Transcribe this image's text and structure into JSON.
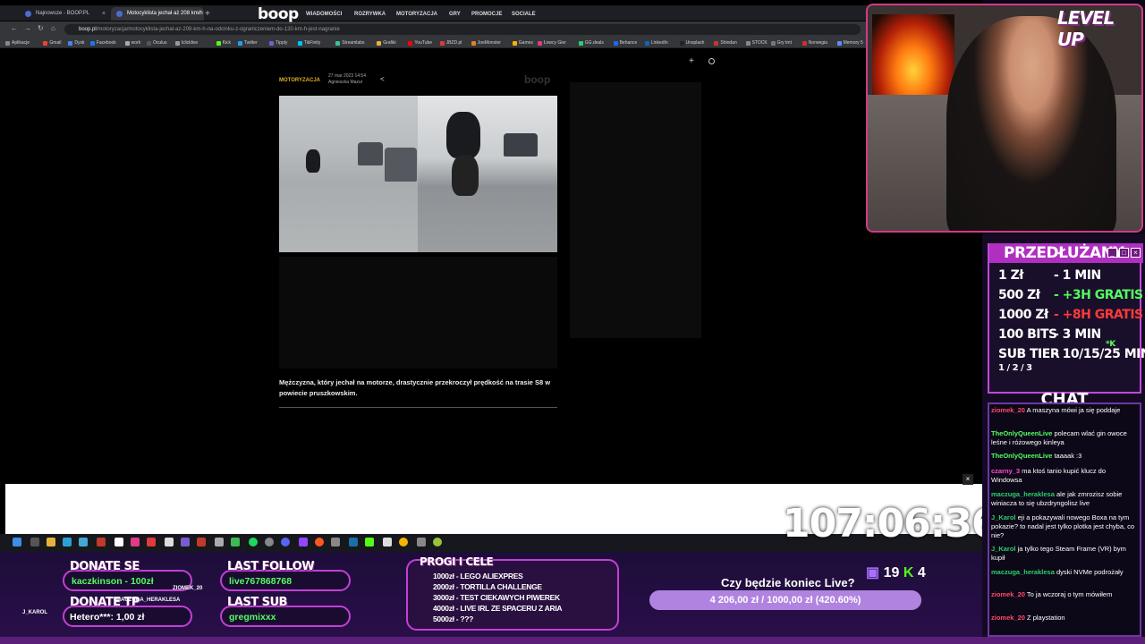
{
  "browser": {
    "tabs": [
      {
        "label": "Najnowsze - BOOP.PL"
      },
      {
        "label": "Motocyklista jechał aż 208 km/h"
      }
    ],
    "url_host": "boop.pl",
    "url_path": "/motoryzacja/motocyklista-jechal-az-208-km-h-na-odcinku-z-ograniczeniem-do-120-km-h-jest-nagranie",
    "bookmarks": [
      "Aplikacje",
      "Gmail",
      "Dysk",
      "Facebook",
      "work",
      "Oculus",
      "Iclicklive",
      "Kick",
      "Twitter",
      "Tipply",
      "TikFinity",
      "Streamlabs",
      "Grafiki",
      "YouTube",
      "JBZD.pl",
      "JoeMonster",
      "Games",
      "Łowcy Gier",
      "GG.deals",
      "Behance",
      "LinkedIn",
      "Unsplash",
      "Shindan",
      "STOCK",
      "Gry tmt",
      "Norwegia",
      "Memory 5"
    ]
  },
  "site": {
    "logo": "boop",
    "nav": [
      "WIADOMOŚCI",
      "ROZRYWKA",
      "MOTORYZACJA",
      "GRY",
      "PROMOCJE",
      "SOCIALE"
    ],
    "category": "MOTORYZACJA",
    "meta_date": "27 mar 2023 14:54",
    "meta_author": "Agnieszka Mazur",
    "watermark": "boop",
    "caption": "Mężczyzna, który jechał na motorze, drastycznie przekroczył prędkość na trasie S8 w powiecie pruszkowskim."
  },
  "timer": "107:06:36",
  "webcam": {
    "brand": "LEVEL UP"
  },
  "subathon": {
    "title": "PRZEDŁUŻANY",
    "rows": [
      {
        "amount": "1 Zł",
        "time": "- 1 MIN",
        "color": "#ffffff"
      },
      {
        "amount": "500 Zł",
        "time": "- +3H GRATIS",
        "color": "#52ff60"
      },
      {
        "amount": "1000 Zł",
        "time": "- +8H GRATIS",
        "color": "#ff3a3a"
      },
      {
        "amount": "100 BITS",
        "time": "- 3 MIN",
        "color": "#ffffff"
      },
      {
        "amount": "SUB TIER",
        "time": "- 10/15/25 MIN",
        "color": "#ffffff"
      }
    ],
    "tier_sub": "1 / 2 / 3",
    "tier_k": "*K"
  },
  "chat": {
    "title": "CHAT",
    "messages": [
      {
        "user": "ziomek_20",
        "color": "#ff4a6a",
        "text": "A maszyna mówi ja się poddaje"
      },
      {
        "user": "TheOnlyQueenLive",
        "color": "#52ff60",
        "text": "polecam wlać gin owoce leśne i różowego kinleya"
      },
      {
        "user": "TheOnlyQueenLive",
        "color": "#52ff60",
        "text": "taaaak :3"
      },
      {
        "user": "czarny_3",
        "color": "#ff4ad0",
        "text": "ma ktoś tanio kupić klucz do Windowsa"
      },
      {
        "user": "maczuga_heraklesa",
        "color": "#2bd06a",
        "text": "ale jak zmrozisz sobie winiacza to się ubzdryngolisz live"
      },
      {
        "user": "J_Karol",
        "color": "#2bd06a",
        "text": "eji a pokazywali nowego Boxa na tym pokazie? to nadal jest tylko plotka jest chyba, co nie?"
      },
      {
        "user": "J_Karol",
        "color": "#2bd06a",
        "text": "ja tylko tego Steam Frame (VR) bym kupił"
      },
      {
        "user": "maczuga_heraklesa",
        "color": "#2bd06a",
        "text": "dyski NVMe podrożały"
      },
      {
        "user": "ziomek_20",
        "color": "#ff4a6a",
        "text": "To ja wczoraj o tym mówiłem"
      },
      {
        "user": "ziomek_20",
        "color": "#ff4a6a",
        "text": "Z playstation"
      }
    ]
  },
  "overlay": {
    "donate_label": "DONATE SE",
    "donate_value": "kaczkinson - 100zł",
    "donate_tp_label": "DONATE TP",
    "donate_tp_value": "Hetero***: 1,00 zł",
    "donate_tp_user": "MACZUGA_HERAKLESA",
    "ziomek_tag": "ZIOMEK_20",
    "jkarol_tag": "J_KAROL",
    "follow_label": "LAST FOLLOW",
    "follow_value": "live767868768",
    "sub_label": "LAST SUB",
    "sub_value": "gregmixxx",
    "goals_title": "PROGI I CELE",
    "goals": [
      "1000zł - LEGO ALIEXPRES",
      "2000zł - TORTILLA CHALLENGE",
      "3000zł - TEST CIEKAWYCH PIWEREK",
      "4000zł - LIVE IRL ZE SPACERU Z ARIA",
      "5000zł - ???"
    ],
    "end_question": "Czy będzie koniec Live?",
    "progress_text": "4 206,00 zł / 1000,00 zł (420.60%)",
    "progress_fraction": 1.0,
    "subs_count": "19",
    "kick_count": "4"
  }
}
